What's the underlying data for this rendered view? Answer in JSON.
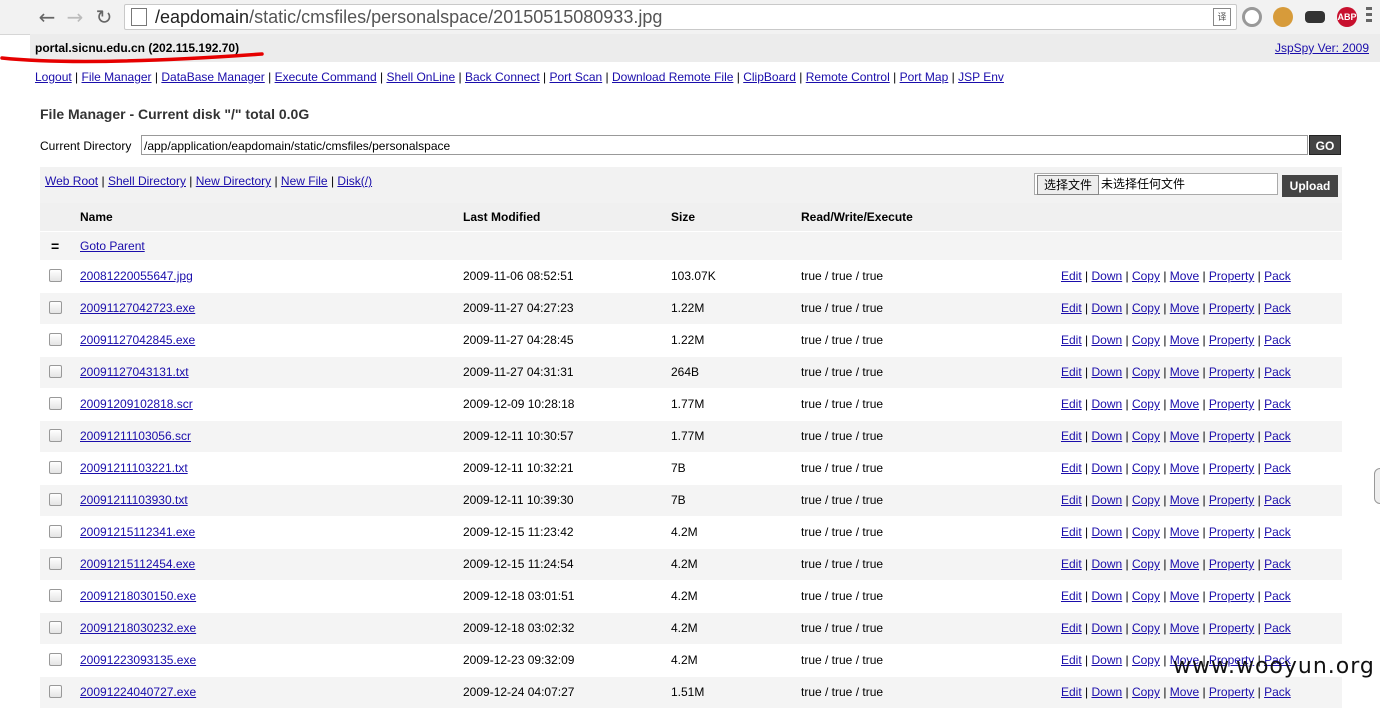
{
  "browser": {
    "url_host": "/eapdomain",
    "url_path": "/static/cmsfiles/personalspace/20150515080933.jpg",
    "back_icon": "back-arrow-icon",
    "forward_icon": "forward-arrow-icon",
    "reload_icon": "reload-icon",
    "translate_icon": "translate-icon",
    "ext_abp_label": "ABP"
  },
  "header": {
    "host": "portal.sicnu.edu.cn (202.115.192.70)",
    "version_link": "JspSpy Ver: 2009"
  },
  "nav": [
    "Logout",
    "File Manager",
    "DataBase Manager",
    "Execute Command",
    "Shell OnLine",
    "Back Connect",
    "Port Scan",
    "Download Remote File",
    "ClipBoard",
    "Remote Control",
    "Port Map",
    "JSP Env"
  ],
  "page": {
    "title": "File Manager - Current disk \"/\" total 0.0G",
    "current_dir_label": "Current Directory",
    "current_dir_value": "/app/application/eapdomain/static/cmsfiles/personalspace",
    "go_label": "GO"
  },
  "toolbar": {
    "links": [
      "Web Root",
      "Shell Directory",
      "New Directory",
      "New File",
      "Disk(/)"
    ],
    "choose_file": "选择文件",
    "no_file": "未选择任何文件",
    "upload": "Upload"
  },
  "table": {
    "headers": {
      "name": "Name",
      "modified": "Last Modified",
      "size": "Size",
      "rwx": "Read/Write/Execute"
    },
    "parent_symbol": "=",
    "parent_link": "Goto Parent",
    "actions": [
      "Edit",
      "Down",
      "Copy",
      "Move",
      "Property",
      "Pack"
    ],
    "rows": [
      {
        "name": "20081220055647.jpg",
        "modified": "2009-11-06 08:52:51",
        "size": "103.07K",
        "rwx": "true / true / true"
      },
      {
        "name": "20091127042723.exe",
        "modified": "2009-11-27 04:27:23",
        "size": "1.22M",
        "rwx": "true / true / true"
      },
      {
        "name": "20091127042845.exe",
        "modified": "2009-11-27 04:28:45",
        "size": "1.22M",
        "rwx": "true / true / true"
      },
      {
        "name": "20091127043131.txt",
        "modified": "2009-11-27 04:31:31",
        "size": "264B",
        "rwx": "true / true / true"
      },
      {
        "name": "20091209102818.scr",
        "modified": "2009-12-09 10:28:18",
        "size": "1.77M",
        "rwx": "true / true / true"
      },
      {
        "name": "20091211103056.scr",
        "modified": "2009-12-11 10:30:57",
        "size": "1.77M",
        "rwx": "true / true / true"
      },
      {
        "name": "20091211103221.txt",
        "modified": "2009-12-11 10:32:21",
        "size": "7B",
        "rwx": "true / true / true"
      },
      {
        "name": "20091211103930.txt",
        "modified": "2009-12-11 10:39:30",
        "size": "7B",
        "rwx": "true / true / true"
      },
      {
        "name": "20091215112341.exe",
        "modified": "2009-12-15 11:23:42",
        "size": "4.2M",
        "rwx": "true / true / true"
      },
      {
        "name": "20091215112454.exe",
        "modified": "2009-12-15 11:24:54",
        "size": "4.2M",
        "rwx": "true / true / true"
      },
      {
        "name": "20091218030150.exe",
        "modified": "2009-12-18 03:01:51",
        "size": "4.2M",
        "rwx": "true / true / true"
      },
      {
        "name": "20091218030232.exe",
        "modified": "2009-12-18 03:02:32",
        "size": "4.2M",
        "rwx": "true / true / true"
      },
      {
        "name": "20091223093135.exe",
        "modified": "2009-12-23 09:32:09",
        "size": "4.2M",
        "rwx": "true / true / true"
      },
      {
        "name": "20091224040727.exe",
        "modified": "2009-12-24 04:07:27",
        "size": "1.51M",
        "rwx": "true / true / true"
      }
    ]
  },
  "watermark": "www.wooyun.org",
  "colors": {
    "link": "#1a0dab",
    "button_dark": "#444444",
    "highlight_mark": "#e60000"
  }
}
